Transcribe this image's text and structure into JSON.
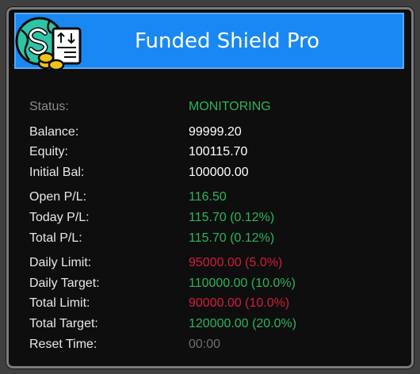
{
  "header": {
    "title": "Funded Shield Pro",
    "logo_icon": "dollar-globe-document-coins-icon",
    "bg_color": "#1a88f2"
  },
  "colors": {
    "positive": "#2ab55c",
    "negative": "#d41b3c",
    "neutral": "#ffffff",
    "muted": "#6f6f6f"
  },
  "stats": {
    "status": {
      "label": "Status:",
      "value": "MONITORING"
    },
    "balance": {
      "label": "Balance:",
      "value": "99999.20"
    },
    "equity": {
      "label": "Equity:",
      "value": "100115.70"
    },
    "initial_bal": {
      "label": "Initial Bal:",
      "value": "100000.00"
    },
    "open_pl": {
      "label": "Open P/L:",
      "value": "116.50"
    },
    "today_pl": {
      "label": "Today P/L:",
      "value": "115.70 (0.12%)"
    },
    "total_pl": {
      "label": "Total P/L:",
      "value": "115.70 (0.12%)"
    },
    "daily_limit": {
      "label": "Daily Limit:",
      "value": "95000.00 (5.0%)"
    },
    "daily_target": {
      "label": "Daily Target:",
      "value": "110000.00 (10.0%)"
    },
    "total_limit": {
      "label": "Total Limit:",
      "value": "90000.00 (10.0%)"
    },
    "total_target": {
      "label": "Total Target:",
      "value": "120000.00 (20.0%)"
    },
    "reset_time": {
      "label": "Reset Time:",
      "value": "00:00"
    }
  }
}
